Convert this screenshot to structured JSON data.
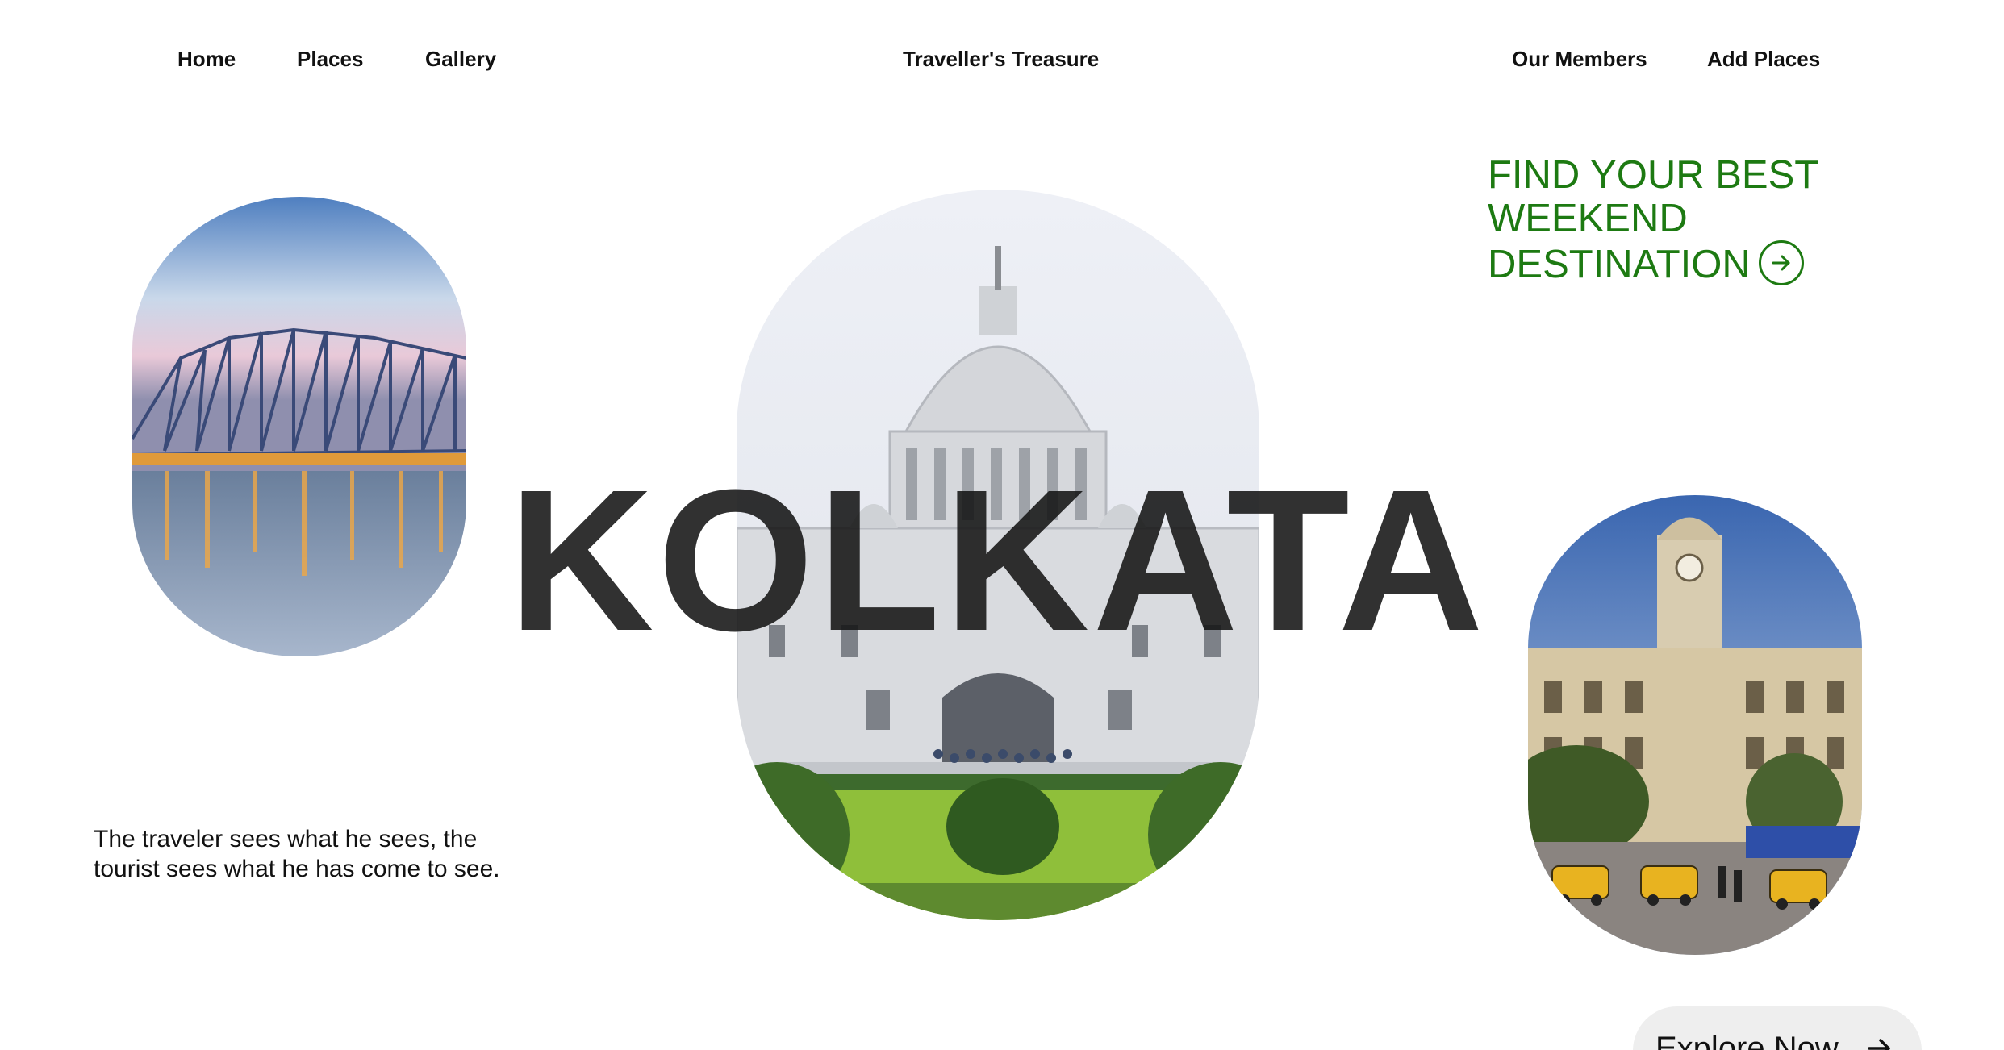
{
  "nav": {
    "home": "Home",
    "places": "Places",
    "gallery": "Gallery",
    "brand": "Traveller's Treasure",
    "members": "Our Members",
    "add_places": "Add Places"
  },
  "tagline": {
    "line1": "FIND YOUR BEST",
    "line2": "WEEKEND",
    "line3": "DESTINATION",
    "arrow_icon": "arrow-right-circle-icon"
  },
  "hero": {
    "title": "KOLKATA"
  },
  "images": {
    "left": "howrah-bridge-photo",
    "center": "victoria-memorial-photo",
    "right": "colonial-building-with-taxis-photo"
  },
  "quote": {
    "text": "The traveler sees what he sees, the tourist sees what he has come to see."
  },
  "cta": {
    "label": "Explore Now",
    "icon": "arrow-right-icon"
  },
  "colors": {
    "accent_green": "#1d7a12",
    "text": "#111111",
    "button_bg": "#eeeeee"
  }
}
